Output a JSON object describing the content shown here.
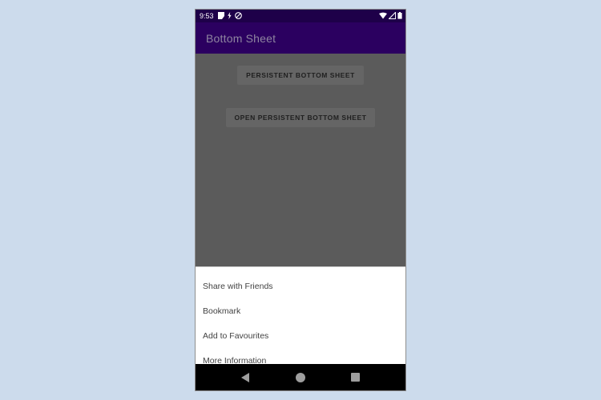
{
  "page": {
    "background_color": "#ccdbec"
  },
  "device": {
    "frame_border_color": "#8e8e8e"
  },
  "status_bar": {
    "clock": "9:53",
    "background_color": "#1e0049",
    "left_icons": [
      {
        "name": "vibrate-mode-icon"
      },
      {
        "name": "lightning-bolt-icon"
      },
      {
        "name": "do-not-disturb-icon"
      }
    ],
    "right_icons": [
      {
        "name": "wifi-icon"
      },
      {
        "name": "cell-signal-icon"
      },
      {
        "name": "battery-icon"
      }
    ]
  },
  "app_bar": {
    "title": "Bottom Sheet",
    "background_color": "#2b0060",
    "title_color": "#8f85a0"
  },
  "content": {
    "scrim_color": "#5b5b5b",
    "buttons": [
      {
        "id": "persistent-bottom-sheet",
        "label": "PERSISTENT BOTTOM SHEET"
      },
      {
        "id": "open-persistent-bottom-sheet",
        "label": "OPEN PERSISTENT BOTTOM SHEET"
      }
    ]
  },
  "bottom_sheet": {
    "background_color": "#ffffff",
    "items": [
      {
        "label": "Share with Friends"
      },
      {
        "label": "Bookmark"
      },
      {
        "label": "Add to Favourites"
      },
      {
        "label": "More Information"
      }
    ]
  },
  "nav_bar": {
    "background_color": "#000000",
    "icon_color": "#9e9e9e",
    "buttons": [
      {
        "name": "back-icon"
      },
      {
        "name": "home-icon"
      },
      {
        "name": "recents-icon"
      }
    ]
  }
}
